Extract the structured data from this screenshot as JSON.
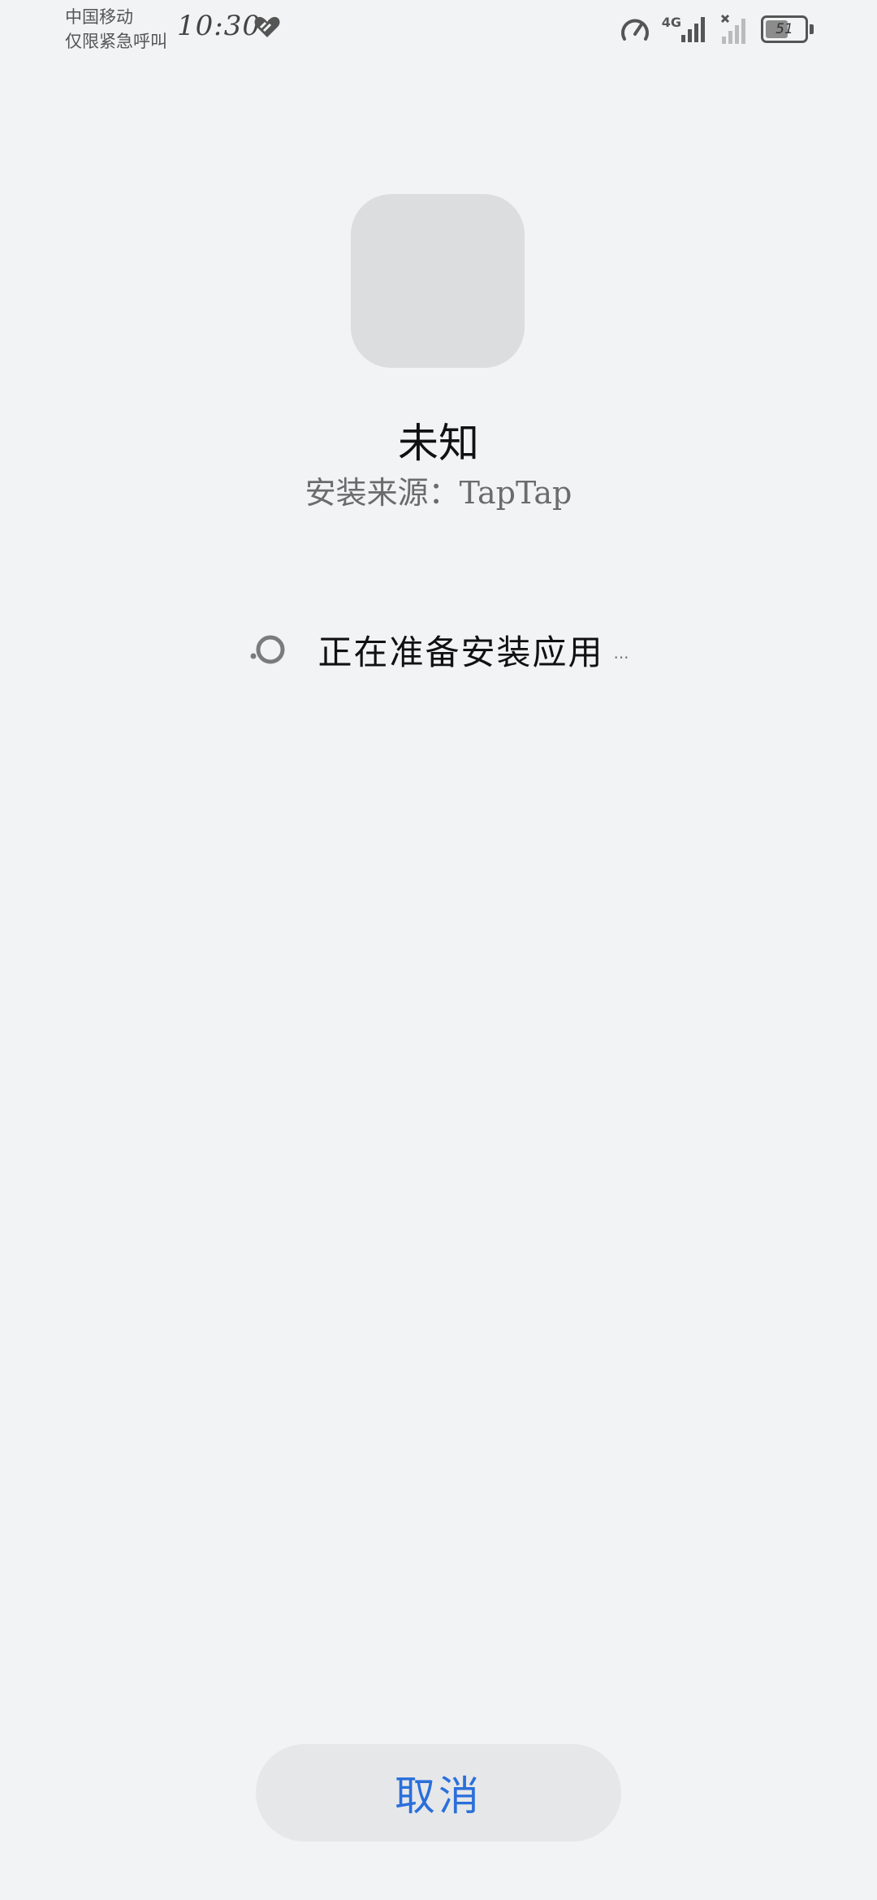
{
  "status_bar": {
    "carrier_line1": "中国移动",
    "carrier_line2": "仅限紧急呼叫",
    "time": "10:30",
    "network_type": "4G",
    "battery_level": "51",
    "icons": [
      "heart-icon",
      "speed-gauge-icon",
      "signal-icon",
      "no-signal-icon",
      "battery-icon"
    ]
  },
  "app": {
    "name": "未知",
    "install_source": "安装来源：TapTap"
  },
  "progress": {
    "text": "正在准备安装应用",
    "ellipsis": "..."
  },
  "actions": {
    "cancel_label": "取消"
  },
  "colors": {
    "background": "#f2f3f5",
    "accent": "#2a6fdb",
    "button_bg": "#e6e7e9",
    "icon_placeholder": "#dcdddf"
  }
}
